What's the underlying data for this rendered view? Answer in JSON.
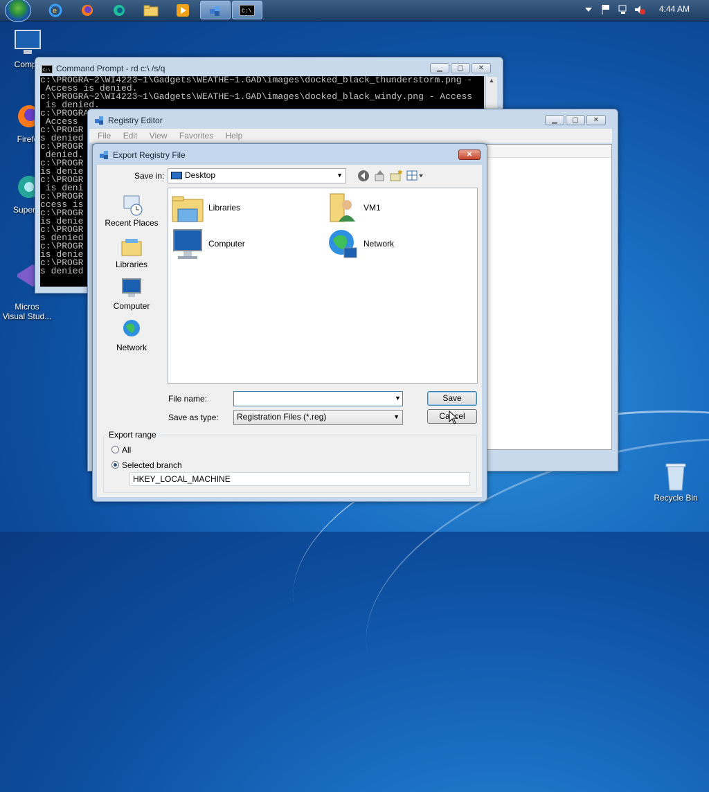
{
  "taskbar": {
    "clock": "4:44 AM",
    "pinned": [
      "ie-icon",
      "firefox-icon",
      "edge-icon",
      "folder-icon",
      "media-player-icon",
      "regedit-icon",
      "cmd-icon"
    ]
  },
  "desktop": {
    "icons": [
      {
        "label": "Compu",
        "icon": "computer-icon"
      },
      {
        "label": "Firefo",
        "icon": "firefox-icon"
      },
      {
        "label": "Superm",
        "icon": "supermium-icon"
      },
      {
        "label": "Micros\nVisual Stud...",
        "icon": "visual-studio-icon"
      },
      {
        "label": "Recycle Bin",
        "icon": "recycle-bin-icon"
      }
    ]
  },
  "cmd": {
    "title": "Command Prompt - rd  c:\\ /s/q",
    "lines": [
      "c:\\PROGRA~2\\WI4223~1\\Gadgets\\WEATHE~1.GAD\\images\\docked_black_thunderstorm.png -",
      " Access is denied.",
      "c:\\PROGRA~2\\WI4223~1\\Gadgets\\WEATHE~1.GAD\\images\\docked_black_windy.png - Access",
      " is denied.",
      "c:\\PROGRA~2\\WI4223~1\\Gadgets\\WEATHE~1.GAD\\images\\docked_black_windy.png - Access",
      " Access",
      "c:\\PROGR",
      "s denied",
      "c:\\PROGR",
      " denied.",
      "c:\\PROGR",
      "is denie",
      "c:\\PROGR",
      " is deni",
      "c:\\PROGR",
      "ccess is",
      "c:\\PROGR",
      "is denie",
      "c:\\PROGR",
      "s denied",
      "c:\\PROGR",
      "is denie",
      "c:\\PROGR",
      "s denied"
    ]
  },
  "regedit": {
    "title": "Registry Editor",
    "menu": [
      "File",
      "Edit",
      "View",
      "Favorites",
      "Help"
    ]
  },
  "dialog": {
    "title": "Export Registry File",
    "save_in_label": "Save in:",
    "save_in_value": "Desktop",
    "places": [
      {
        "label": "Recent Places",
        "icon": "recent-places-icon"
      },
      {
        "label": "Libraries",
        "icon": "libraries-icon"
      },
      {
        "label": "Computer",
        "icon": "computer-icon"
      },
      {
        "label": "Network",
        "icon": "network-icon"
      }
    ],
    "files": [
      {
        "label": "Libraries",
        "icon": "libraries-folder-icon"
      },
      {
        "label": "VM1",
        "icon": "user-folder-icon"
      },
      {
        "label": "Computer",
        "icon": "computer-icon"
      },
      {
        "label": "Network",
        "icon": "network-icon"
      }
    ],
    "file_name_label": "File name:",
    "file_name_value": "",
    "save_as_type_label": "Save as type:",
    "save_as_type_value": "Registration Files (*.reg)",
    "save_button": "Save",
    "cancel_button": "Cancel",
    "export_range": {
      "legend": "Export range",
      "all_label": "All",
      "selected_label": "Selected branch",
      "selected": "Selected branch",
      "branch_value": "HKEY_LOCAL_MACHINE"
    }
  },
  "colors": {
    "taskbar": "#2a4a73",
    "dialog_frame": "#c9d9ec",
    "console_bg": "#000000",
    "console_fg": "#c0c0c0"
  }
}
